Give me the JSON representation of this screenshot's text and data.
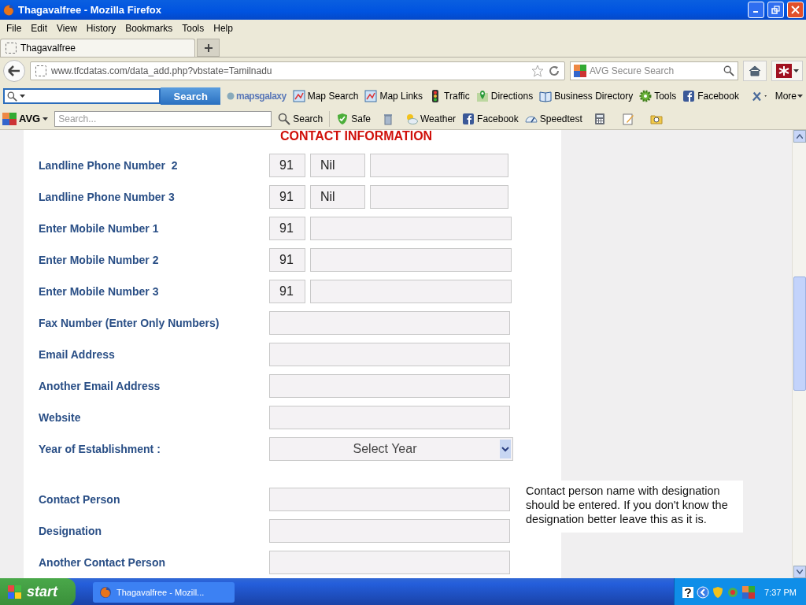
{
  "window": {
    "title": "Thagavalfree - Mozilla Firefox"
  },
  "menu": [
    "File",
    "Edit",
    "View",
    "History",
    "Bookmarks",
    "Tools",
    "Help"
  ],
  "tabs": [
    {
      "label": "Thagavalfree",
      "selected": true
    }
  ],
  "address": {
    "url": "www.tfcdatas.com/data_add.php?vbstate=Tamilnadu"
  },
  "web_search": {
    "placeholder": "AVG Secure Search"
  },
  "mapsgalaxy_toolbar": {
    "search_button": "Search",
    "logo": "mapsgalaxy",
    "more": "More",
    "links": [
      {
        "label": "Map Search",
        "kind": "map"
      },
      {
        "label": "Map Links",
        "kind": "map"
      },
      {
        "label": "Traffic",
        "kind": "traffic"
      },
      {
        "label": "Directions",
        "kind": "pin"
      },
      {
        "label": "Business Directory",
        "kind": "book"
      },
      {
        "label": "Tools",
        "kind": "gear"
      },
      {
        "label": "Facebook",
        "kind": "facebook"
      }
    ]
  },
  "avg_toolbar": {
    "brand": "AVG",
    "placeholder": "Search...",
    "search_button": "Search",
    "items": [
      {
        "label": "Safe",
        "kind": "shield"
      },
      {
        "kind": "trash"
      },
      {
        "label": "Weather",
        "kind": "weather"
      },
      {
        "label": "Facebook",
        "kind": "facebook"
      },
      {
        "label": "Speedtest",
        "kind": "gauge"
      },
      {
        "kind": "calculator"
      },
      {
        "kind": "notepad"
      },
      {
        "kind": "folder"
      }
    ]
  },
  "form": {
    "heading": "CONTACT INFORMATION",
    "groups": [
      {
        "rows": [
          {
            "label": "Landline Phone Number  2",
            "kind": "landline",
            "code": "91",
            "area": "Nil"
          },
          {
            "label": "Landline Phone Number 3",
            "kind": "landline",
            "code": "91",
            "area": "Nil"
          },
          {
            "label": "Enter Mobile Number 1",
            "kind": "mobile",
            "code": "91"
          },
          {
            "label": "Enter Mobile Number 2",
            "kind": "mobile",
            "code": "91"
          },
          {
            "label": "Enter Mobile Number 3",
            "kind": "mobile",
            "code": "91"
          },
          {
            "label": "Fax Number (Enter Only Numbers)",
            "kind": "text"
          },
          {
            "label": "Email Address",
            "kind": "text"
          },
          {
            "label": "Another Email Address",
            "kind": "text"
          },
          {
            "label": "Website",
            "kind": "text"
          },
          {
            "label": "Year of Establishment :",
            "kind": "select",
            "value": "Select Year"
          }
        ]
      },
      {
        "rows": [
          {
            "label": "Contact Person",
            "kind": "text"
          },
          {
            "label": "Designation",
            "kind": "text"
          },
          {
            "label": "Another Contact Person",
            "kind": "text"
          }
        ],
        "note": "Contact person name with designation should be entered. If you don't know the designation better leave this as it is."
      }
    ]
  },
  "taskbar": {
    "start": "start",
    "tasks": [
      {
        "label": "Thagavalfree - Mozill...",
        "selected": false
      }
    ],
    "clock": "7:37 PM"
  }
}
